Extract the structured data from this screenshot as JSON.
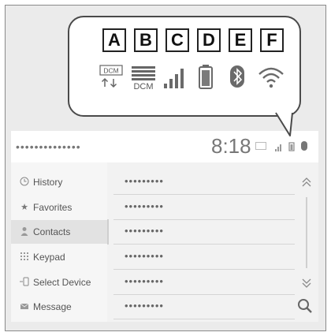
{
  "callout": {
    "labels": [
      "A",
      "B",
      "C",
      "D",
      "E",
      "F"
    ],
    "icons": [
      "dcm-upload-download-icon",
      "dcm-signal-icon",
      "signal-strength-icon",
      "battery-icon",
      "bluetooth-icon",
      "wifi-icon"
    ],
    "dcm_text_a": "DCM",
    "dcm_text_b": "DCM"
  },
  "status_bar": {
    "title": "••••••••••••••",
    "time": "8:18"
  },
  "sidebar": {
    "items": [
      {
        "label": "History",
        "icon": "clock-icon"
      },
      {
        "label": "Favorites",
        "icon": "star-icon"
      },
      {
        "label": "Contacts",
        "icon": "person-icon"
      },
      {
        "label": "Keypad",
        "icon": "keypad-icon"
      },
      {
        "label": "Select Device",
        "icon": "phone-device-icon"
      },
      {
        "label": "Message",
        "icon": "envelope-icon"
      }
    ]
  },
  "list": {
    "rows": [
      "•••••••••",
      "•••••••••",
      "•••••••••",
      "•••••••••",
      "•••••••••",
      "•••••••••"
    ]
  }
}
